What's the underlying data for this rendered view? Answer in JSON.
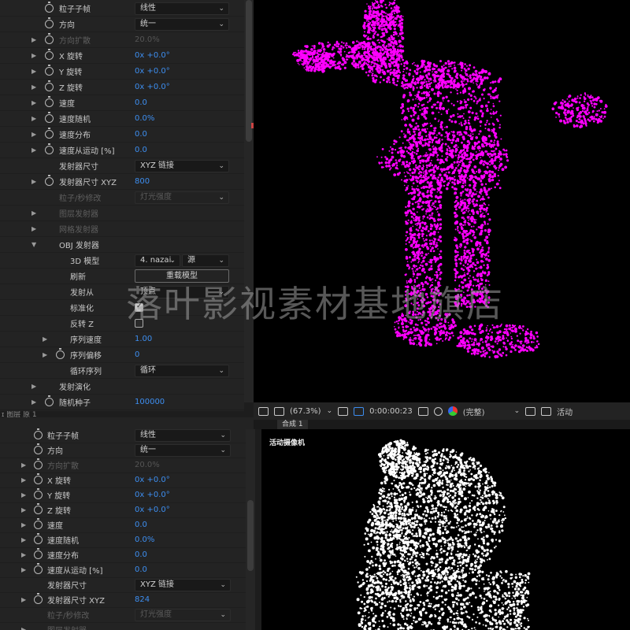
{
  "top_panel": {
    "rows": [
      {
        "label": "粒子子帧",
        "dropdown": "线性",
        "has_twirl": false,
        "stopwatch": true
      },
      {
        "label": "方向",
        "dropdown": "统一",
        "has_twirl": false,
        "stopwatch": true
      },
      {
        "label": "方向扩散",
        "value": "20.0%",
        "has_twirl": true,
        "stopwatch": true,
        "dim": true
      },
      {
        "label": "X 旋转",
        "value": "0x +0.0°",
        "has_twirl": true,
        "stopwatch": true
      },
      {
        "label": "Y 旋转",
        "value": "0x +0.0°",
        "has_twirl": true,
        "stopwatch": true
      },
      {
        "label": "Z 旋转",
        "value": "0x +0.0°",
        "has_twirl": true,
        "stopwatch": true
      },
      {
        "label": "速度",
        "value": "0.0",
        "has_twirl": true,
        "stopwatch": true
      },
      {
        "label": "速度随机",
        "value": "0.0%",
        "has_twirl": true,
        "stopwatch": true
      },
      {
        "label": "速度分布",
        "value": "0.0",
        "has_twirl": true,
        "stopwatch": true
      },
      {
        "label": "速度从运动 [%]",
        "value": "0.0",
        "has_twirl": true,
        "stopwatch": true
      },
      {
        "label": "发射器尺寸",
        "dropdown": "XYZ 链接",
        "has_twirl": false,
        "stopwatch": false
      },
      {
        "label": "发射器尺寸 XYZ",
        "value": "800",
        "has_twirl": true,
        "stopwatch": true
      },
      {
        "label": "粒子/秒修改",
        "dropdown": "灯光强度",
        "has_twirl": false,
        "stopwatch": false,
        "dim": true
      },
      {
        "label": "图层发射器",
        "has_twirl": true,
        "stopwatch": false,
        "dim": true
      },
      {
        "label": "网格发射器",
        "has_twirl": true,
        "stopwatch": false,
        "dim": true
      },
      {
        "label": "OBJ 发射器",
        "has_twirl": true,
        "open": true,
        "stopwatch": false
      },
      {
        "label": "3D 模型",
        "dropdown": "4. nazai.",
        "dropdown2": "源",
        "has_twirl": false,
        "stopwatch": false,
        "indent": 1
      },
      {
        "label": "刷新",
        "button": "重载模型",
        "has_twirl": false,
        "stopwatch": false,
        "indent": 1
      },
      {
        "label": "发射从",
        "dropdown": "顶点",
        "has_twirl": false,
        "stopwatch": false,
        "indent": 1
      },
      {
        "label": "标准化",
        "checkbox": true,
        "has_twirl": false,
        "stopwatch": false,
        "indent": 1
      },
      {
        "label": "反转 Z",
        "checkbox": false,
        "has_twirl": false,
        "stopwatch": false,
        "indent": 1
      },
      {
        "label": "序列速度",
        "value": "1.00",
        "has_twirl": true,
        "stopwatch": false,
        "indent": 1
      },
      {
        "label": "序列偏移",
        "value": "0",
        "has_twirl": true,
        "stopwatch": true,
        "indent": 1
      },
      {
        "label": "循环序列",
        "dropdown": "循环",
        "has_twirl": false,
        "stopwatch": false,
        "indent": 1
      },
      {
        "label": "发射演化",
        "has_twirl": true,
        "stopwatch": false
      },
      {
        "label": "随机种子",
        "value": "100000",
        "has_twirl": true,
        "stopwatch": true
      }
    ]
  },
  "bottom_header_text": "ɪ 图层 原 1",
  "bottom_panel": {
    "rows": [
      {
        "label": "粒子子帧",
        "dropdown": "线性",
        "has_twirl": false,
        "stopwatch": true
      },
      {
        "label": "方向",
        "dropdown": "统一",
        "has_twirl": false,
        "stopwatch": true
      },
      {
        "label": "方向扩散",
        "value": "20.0%",
        "has_twirl": true,
        "stopwatch": true,
        "dim": true
      },
      {
        "label": "X 旋转",
        "value": "0x +0.0°",
        "has_twirl": true,
        "stopwatch": true
      },
      {
        "label": "Y 旋转",
        "value": "0x +0.0°",
        "has_twirl": true,
        "stopwatch": true
      },
      {
        "label": "Z 旋转",
        "value": "0x +0.0°",
        "has_twirl": true,
        "stopwatch": true
      },
      {
        "label": "速度",
        "value": "0.0",
        "has_twirl": true,
        "stopwatch": true
      },
      {
        "label": "速度随机",
        "value": "0.0%",
        "has_twirl": true,
        "stopwatch": true
      },
      {
        "label": "速度分布",
        "value": "0.0",
        "has_twirl": true,
        "stopwatch": true
      },
      {
        "label": "速度从运动 [%]",
        "value": "0.0",
        "has_twirl": true,
        "stopwatch": true
      },
      {
        "label": "发射器尺寸",
        "dropdown": "XYZ 链接",
        "has_twirl": false,
        "stopwatch": false
      },
      {
        "label": "发射器尺寸 XYZ",
        "value": "824",
        "has_twirl": true,
        "stopwatch": true
      },
      {
        "label": "粒子/秒修改",
        "dropdown": "灯光强度",
        "has_twirl": false,
        "stopwatch": false,
        "dim": true
      },
      {
        "label": "图层发射器",
        "has_twirl": true,
        "stopwatch": false,
        "dim": true
      }
    ]
  },
  "toolbar": {
    "zoom": "(67.3%)",
    "timecode": "0:00:00:23",
    "resolution": "(完整)",
    "camera": "活动"
  },
  "viewer_tab": "合成 1",
  "bottom_viewer_label": "活动摄像机",
  "watermark": "落叶影视素材基地旗店",
  "colors": {
    "particles_top": "#ff00ff",
    "particles_bottom": "#ffffff",
    "value_blue": "#3d8ef0"
  }
}
